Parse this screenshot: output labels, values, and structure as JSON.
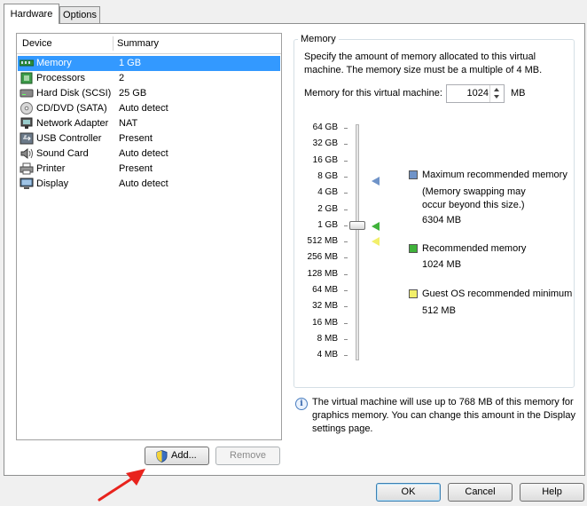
{
  "tabs": [
    {
      "label": "Hardware",
      "active": true
    },
    {
      "label": "Options",
      "active": false
    }
  ],
  "device_list": {
    "columns": [
      "Device",
      "Summary"
    ],
    "rows": [
      {
        "icon": "memory-icon",
        "device": "Memory",
        "summary": "1 GB",
        "selected": true
      },
      {
        "icon": "processor-icon",
        "device": "Processors",
        "summary": "2"
      },
      {
        "icon": "hard-disk-icon",
        "device": "Hard Disk (SCSI)",
        "summary": "25 GB"
      },
      {
        "icon": "cd-dvd-icon",
        "device": "CD/DVD (SATA)",
        "summary": "Auto detect"
      },
      {
        "icon": "network-adapter-icon",
        "device": "Network Adapter",
        "summary": "NAT"
      },
      {
        "icon": "usb-icon",
        "device": "USB Controller",
        "summary": "Present"
      },
      {
        "icon": "sound-card-icon",
        "device": "Sound Card",
        "summary": "Auto detect"
      },
      {
        "icon": "printer-icon",
        "device": "Printer",
        "summary": "Present"
      },
      {
        "icon": "display-icon",
        "device": "Display",
        "summary": "Auto detect"
      }
    ]
  },
  "buttons": {
    "add": "Add...",
    "remove": "Remove",
    "ok": "OK",
    "cancel": "Cancel",
    "help": "Help"
  },
  "memory": {
    "group_title": "Memory",
    "description": "Specify the amount of memory allocated to this virtual machine. The memory size must be a multiple of 4 MB.",
    "field_label": "Memory for this virtual machine:",
    "value": "1024",
    "unit": "MB",
    "scale": [
      "64 GB",
      "32 GB",
      "16 GB",
      "8 GB",
      "4 GB",
      "2 GB",
      "1 GB",
      "512 MB",
      "256 MB",
      "128 MB",
      "64 MB",
      "32 MB",
      "16 MB",
      "8 MB",
      "4 MB"
    ],
    "slider_value": "1 GB",
    "legend": {
      "max_label": "Maximum recommended memory",
      "max_note": "(Memory swapping may occur beyond this size.)",
      "max_value": "6304 MB",
      "rec_label": "Recommended memory",
      "rec_value": "1024 MB",
      "min_label": "Guest OS recommended minimum",
      "min_value": "512 MB"
    },
    "colors": {
      "max": "#6f93c8",
      "recommended": "#3fb23a",
      "minimum": "#f2ef6a"
    }
  },
  "info_text": "The virtual machine will use up to 768 MB of this memory for graphics memory. You can change this amount in the Display settings page."
}
